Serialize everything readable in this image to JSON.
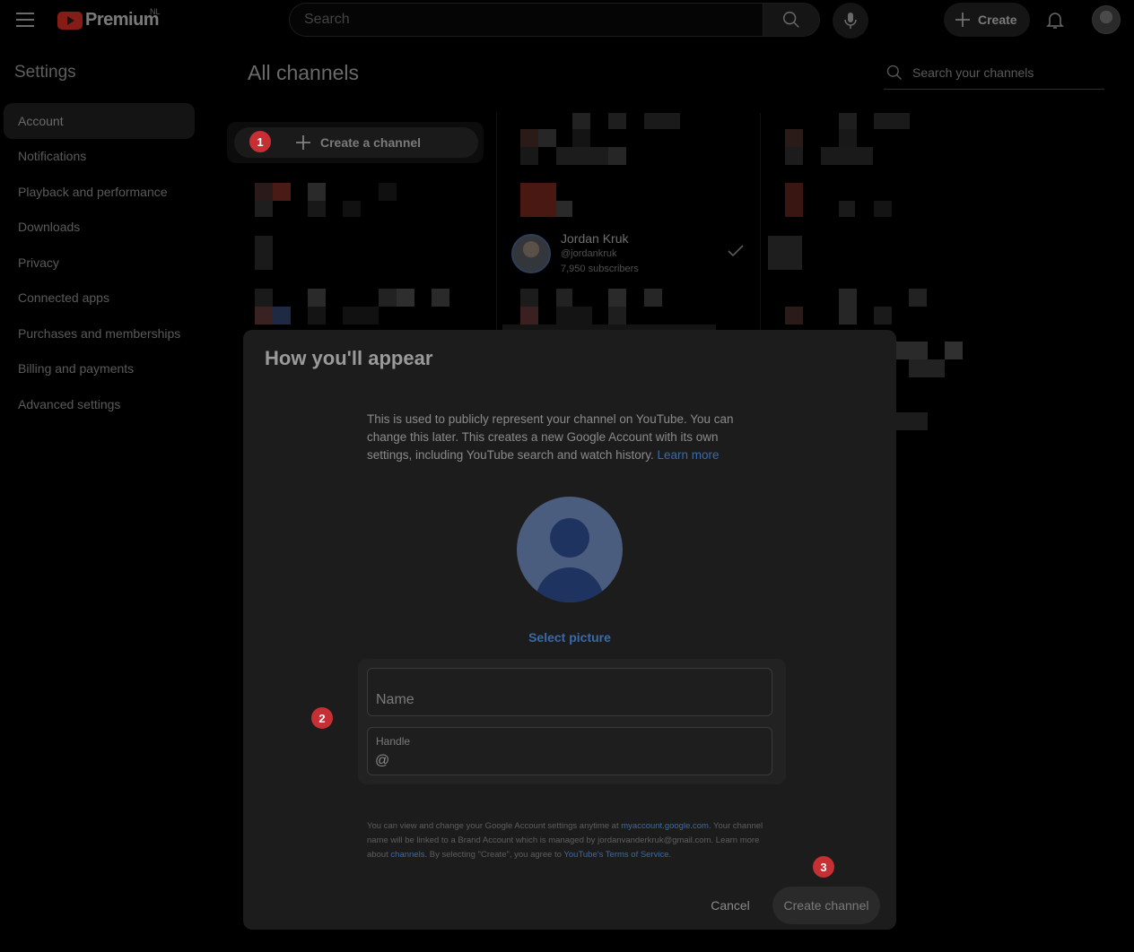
{
  "header": {
    "logo_text": "Premium",
    "region": "NL",
    "search_placeholder": "Search",
    "create_label": "Create"
  },
  "sidebar": {
    "title": "Settings",
    "items": [
      {
        "label": "Account",
        "active": true
      },
      {
        "label": "Notifications"
      },
      {
        "label": "Playback and performance"
      },
      {
        "label": "Downloads"
      },
      {
        "label": "Privacy"
      },
      {
        "label": "Connected apps"
      },
      {
        "label": "Purchases and memberships"
      },
      {
        "label": "Billing and payments"
      },
      {
        "label": "Advanced settings"
      }
    ]
  },
  "main": {
    "title": "All channels",
    "search_placeholder": "Search your channels",
    "create_channel_label": "Create a channel",
    "channel": {
      "name": "Jordan Kruk",
      "handle": "@jordankruk",
      "subscribers": "7,950 subscribers"
    }
  },
  "markers": [
    "1",
    "2",
    "3"
  ],
  "dialog": {
    "title": "How you'll appear",
    "description": "This is used to publicly represent your channel on YouTube. You can change this later. This creates a new Google Account with its own settings, including YouTube search and watch history.",
    "learn_more": "Learn more",
    "select_picture": "Select picture",
    "name_placeholder": "Name",
    "handle_label": "Handle",
    "handle_prefix": "@",
    "fine_print": {
      "part1": "You can view and change your Google Account settings anytime at ",
      "link1": "myaccount.google.com",
      "part2": ". Your channel name will be linked to a Brand Account which is managed by jordanvanderkruk@gmail.com. Learn more about ",
      "link2": "channels",
      "part3": ". By selecting \"Create\", you agree to ",
      "link3": "YouTube's Terms of Service",
      "part4": "."
    },
    "cancel_label": "Cancel",
    "create_label": "Create channel"
  },
  "colors": {
    "marker": "#c62f33",
    "link": "#3a6aa8",
    "dialog_bg": "#1c1c1c",
    "page_bg": "#000000"
  }
}
